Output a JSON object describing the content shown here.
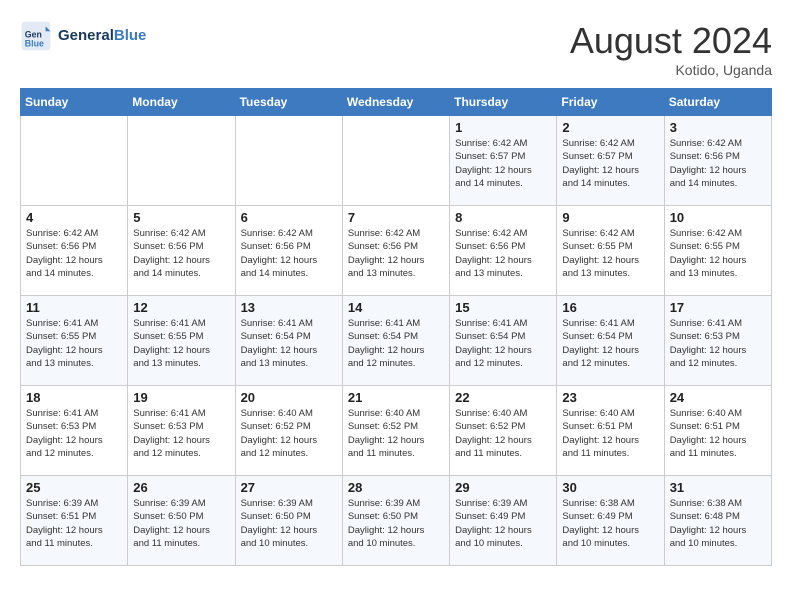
{
  "header": {
    "logo_text_general": "General",
    "logo_text_blue": "Blue",
    "month_year": "August 2024",
    "location": "Kotido, Uganda"
  },
  "weekdays": [
    "Sunday",
    "Monday",
    "Tuesday",
    "Wednesday",
    "Thursday",
    "Friday",
    "Saturday"
  ],
  "weeks": [
    [
      {
        "day": "",
        "info": ""
      },
      {
        "day": "",
        "info": ""
      },
      {
        "day": "",
        "info": ""
      },
      {
        "day": "",
        "info": ""
      },
      {
        "day": "1",
        "info": "Sunrise: 6:42 AM\nSunset: 6:57 PM\nDaylight: 12 hours\nand 14 minutes."
      },
      {
        "day": "2",
        "info": "Sunrise: 6:42 AM\nSunset: 6:57 PM\nDaylight: 12 hours\nand 14 minutes."
      },
      {
        "day": "3",
        "info": "Sunrise: 6:42 AM\nSunset: 6:56 PM\nDaylight: 12 hours\nand 14 minutes."
      }
    ],
    [
      {
        "day": "4",
        "info": "Sunrise: 6:42 AM\nSunset: 6:56 PM\nDaylight: 12 hours\nand 14 minutes."
      },
      {
        "day": "5",
        "info": "Sunrise: 6:42 AM\nSunset: 6:56 PM\nDaylight: 12 hours\nand 14 minutes."
      },
      {
        "day": "6",
        "info": "Sunrise: 6:42 AM\nSunset: 6:56 PM\nDaylight: 12 hours\nand 14 minutes."
      },
      {
        "day": "7",
        "info": "Sunrise: 6:42 AM\nSunset: 6:56 PM\nDaylight: 12 hours\nand 13 minutes."
      },
      {
        "day": "8",
        "info": "Sunrise: 6:42 AM\nSunset: 6:56 PM\nDaylight: 12 hours\nand 13 minutes."
      },
      {
        "day": "9",
        "info": "Sunrise: 6:42 AM\nSunset: 6:55 PM\nDaylight: 12 hours\nand 13 minutes."
      },
      {
        "day": "10",
        "info": "Sunrise: 6:42 AM\nSunset: 6:55 PM\nDaylight: 12 hours\nand 13 minutes."
      }
    ],
    [
      {
        "day": "11",
        "info": "Sunrise: 6:41 AM\nSunset: 6:55 PM\nDaylight: 12 hours\nand 13 minutes."
      },
      {
        "day": "12",
        "info": "Sunrise: 6:41 AM\nSunset: 6:55 PM\nDaylight: 12 hours\nand 13 minutes."
      },
      {
        "day": "13",
        "info": "Sunrise: 6:41 AM\nSunset: 6:54 PM\nDaylight: 12 hours\nand 13 minutes."
      },
      {
        "day": "14",
        "info": "Sunrise: 6:41 AM\nSunset: 6:54 PM\nDaylight: 12 hours\nand 12 minutes."
      },
      {
        "day": "15",
        "info": "Sunrise: 6:41 AM\nSunset: 6:54 PM\nDaylight: 12 hours\nand 12 minutes."
      },
      {
        "day": "16",
        "info": "Sunrise: 6:41 AM\nSunset: 6:54 PM\nDaylight: 12 hours\nand 12 minutes."
      },
      {
        "day": "17",
        "info": "Sunrise: 6:41 AM\nSunset: 6:53 PM\nDaylight: 12 hours\nand 12 minutes."
      }
    ],
    [
      {
        "day": "18",
        "info": "Sunrise: 6:41 AM\nSunset: 6:53 PM\nDaylight: 12 hours\nand 12 minutes."
      },
      {
        "day": "19",
        "info": "Sunrise: 6:41 AM\nSunset: 6:53 PM\nDaylight: 12 hours\nand 12 minutes."
      },
      {
        "day": "20",
        "info": "Sunrise: 6:40 AM\nSunset: 6:52 PM\nDaylight: 12 hours\nand 12 minutes."
      },
      {
        "day": "21",
        "info": "Sunrise: 6:40 AM\nSunset: 6:52 PM\nDaylight: 12 hours\nand 11 minutes."
      },
      {
        "day": "22",
        "info": "Sunrise: 6:40 AM\nSunset: 6:52 PM\nDaylight: 12 hours\nand 11 minutes."
      },
      {
        "day": "23",
        "info": "Sunrise: 6:40 AM\nSunset: 6:51 PM\nDaylight: 12 hours\nand 11 minutes."
      },
      {
        "day": "24",
        "info": "Sunrise: 6:40 AM\nSunset: 6:51 PM\nDaylight: 12 hours\nand 11 minutes."
      }
    ],
    [
      {
        "day": "25",
        "info": "Sunrise: 6:39 AM\nSunset: 6:51 PM\nDaylight: 12 hours\nand 11 minutes."
      },
      {
        "day": "26",
        "info": "Sunrise: 6:39 AM\nSunset: 6:50 PM\nDaylight: 12 hours\nand 11 minutes."
      },
      {
        "day": "27",
        "info": "Sunrise: 6:39 AM\nSunset: 6:50 PM\nDaylight: 12 hours\nand 10 minutes."
      },
      {
        "day": "28",
        "info": "Sunrise: 6:39 AM\nSunset: 6:50 PM\nDaylight: 12 hours\nand 10 minutes."
      },
      {
        "day": "29",
        "info": "Sunrise: 6:39 AM\nSunset: 6:49 PM\nDaylight: 12 hours\nand 10 minutes."
      },
      {
        "day": "30",
        "info": "Sunrise: 6:38 AM\nSunset: 6:49 PM\nDaylight: 12 hours\nand 10 minutes."
      },
      {
        "day": "31",
        "info": "Sunrise: 6:38 AM\nSunset: 6:48 PM\nDaylight: 12 hours\nand 10 minutes."
      }
    ]
  ]
}
